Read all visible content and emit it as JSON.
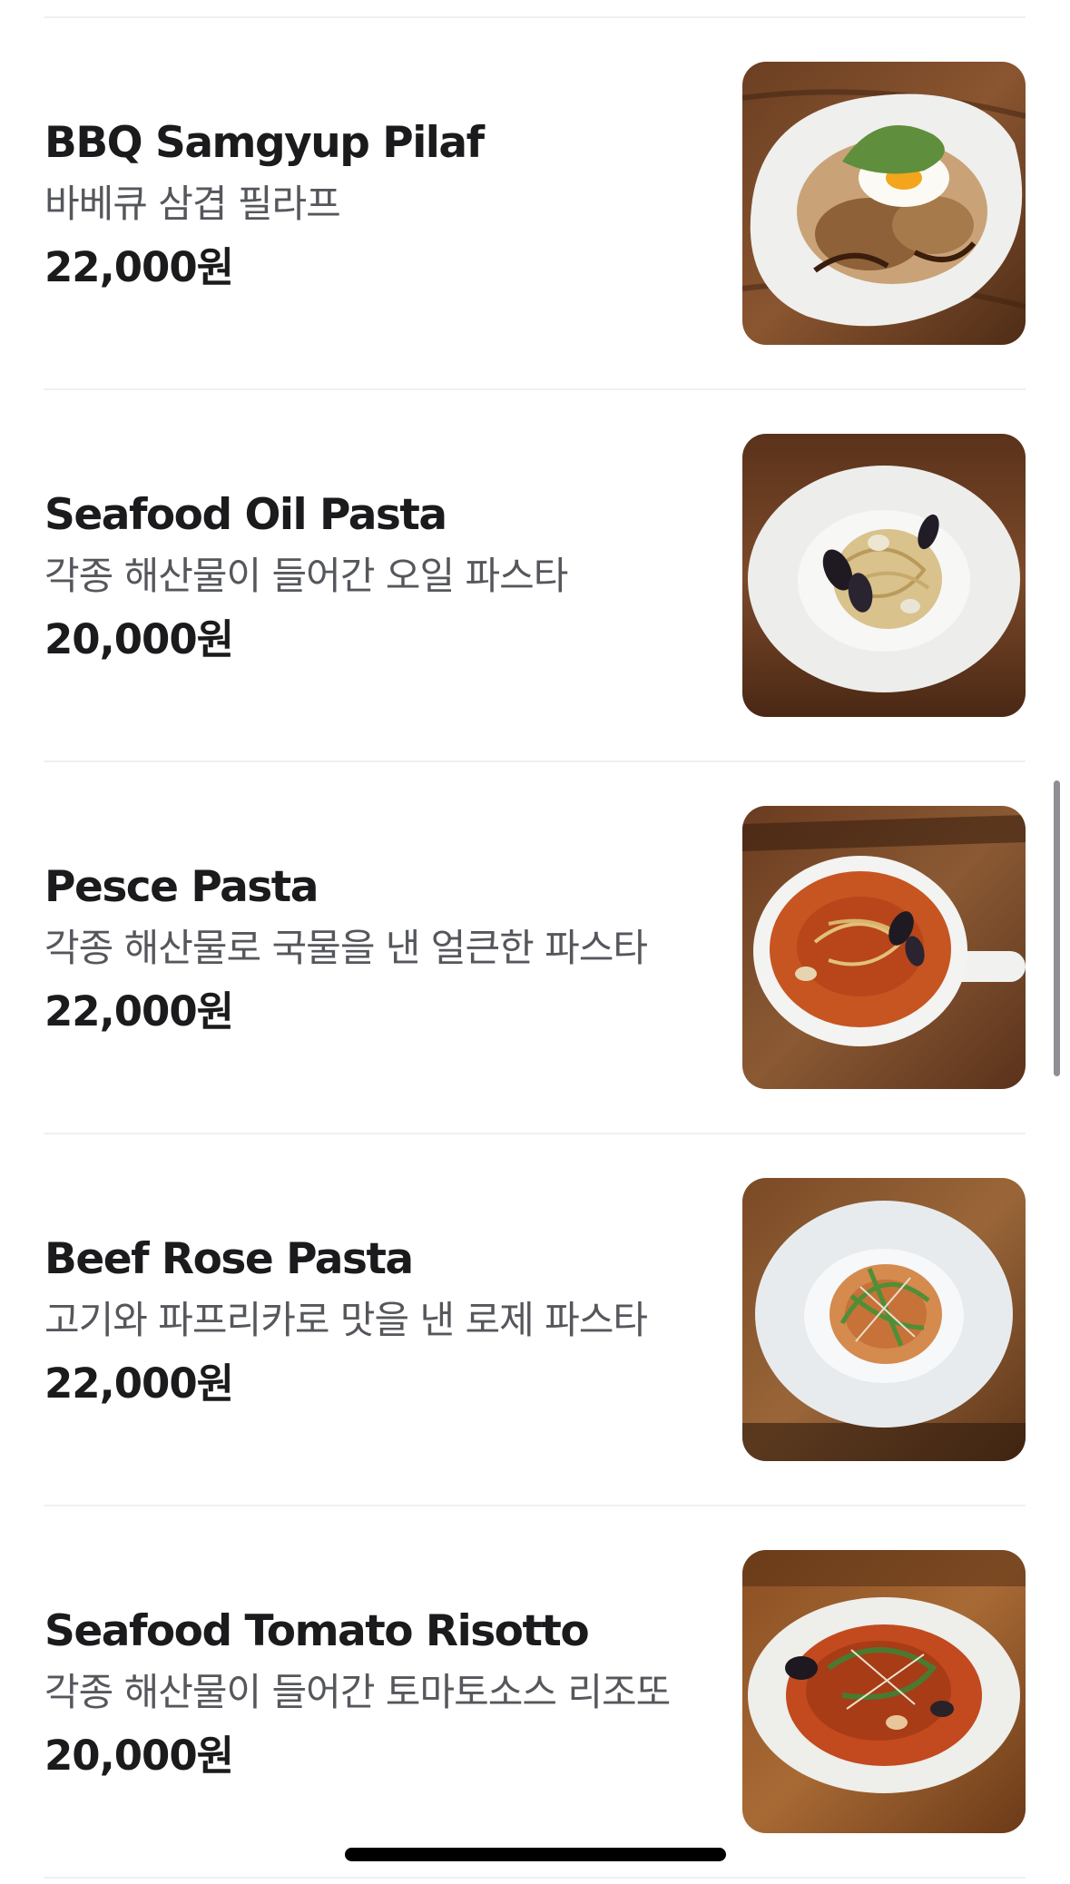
{
  "menu": {
    "items": [
      {
        "name": "BBQ Samgyup Pilaf",
        "description": "바베큐 삼겹 필라프",
        "price": "22,000원"
      },
      {
        "name": "Seafood Oil Pasta",
        "description": "각종 해산물이 들어간 오일 파스타",
        "price": "20,000원"
      },
      {
        "name": "Pesce Pasta",
        "description": "각종 해산물로 국물을 낸 얼큰한 파스타",
        "price": "22,000원"
      },
      {
        "name": "Beef Rose Pasta",
        "description": "고기와 파프리카로 맛을 낸 로제 파스타",
        "price": "22,000원"
      },
      {
        "name": "Seafood Tomato Risotto",
        "description": "각종 해산물이 들어간 토마토소스 리조또",
        "price": "20,000원"
      }
    ]
  },
  "colors": {
    "title_text": "#1b1b1d",
    "description_text": "#55575c",
    "divider": "#eef0f2",
    "background": "#ffffff"
  }
}
